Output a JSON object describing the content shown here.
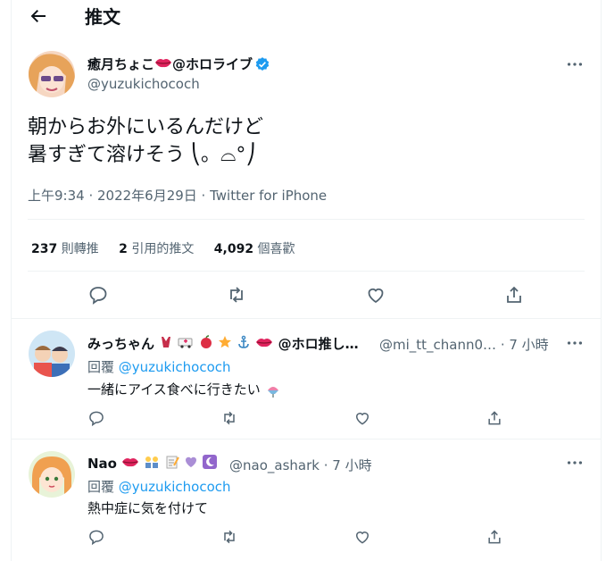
{
  "header": {
    "title": "推文"
  },
  "main_tweet": {
    "author_name": "癒月ちょこ",
    "author_suffix": "@ホロライブ",
    "handle": "@yuzukichococh",
    "text_line1": "朝からお外にいるんだけど",
    "text_line2": "暑すぎて溶けそう ⎝。⌓°⎠",
    "meta": "上午9:34 · 2022年6月29日 · Twitter for iPhone",
    "stats": {
      "retweets_count": "237",
      "retweets_label": "則轉推",
      "quotes_count": "2",
      "quotes_label": "引用的推文",
      "likes_count": "4,092",
      "likes_label": "個喜歡"
    }
  },
  "replies": [
    {
      "author_name": "みっちゃん",
      "author_suffix": "@ホロ推し…",
      "handle": "@mi_tt_chann0…",
      "time": "· 7 小時",
      "replying_label": "回覆",
      "replying_to": "@yuzukichococh",
      "text": "一緒にアイス食べに行きたい"
    },
    {
      "author_name": "Nao",
      "handle": "@nao_ashark",
      "time": "· 7 小時",
      "replying_label": "回覆",
      "replying_to": "@yuzukichococh",
      "text": "熱中症に気を付けて"
    }
  ],
  "icons": [
    "back-arrow-icon",
    "more-icon",
    "verified-icon",
    "reply-icon",
    "retweet-icon",
    "like-icon",
    "share-icon"
  ],
  "colors": {
    "accent": "#1d9bf0",
    "secondary_text": "#536471",
    "divider": "#eff3f4"
  }
}
